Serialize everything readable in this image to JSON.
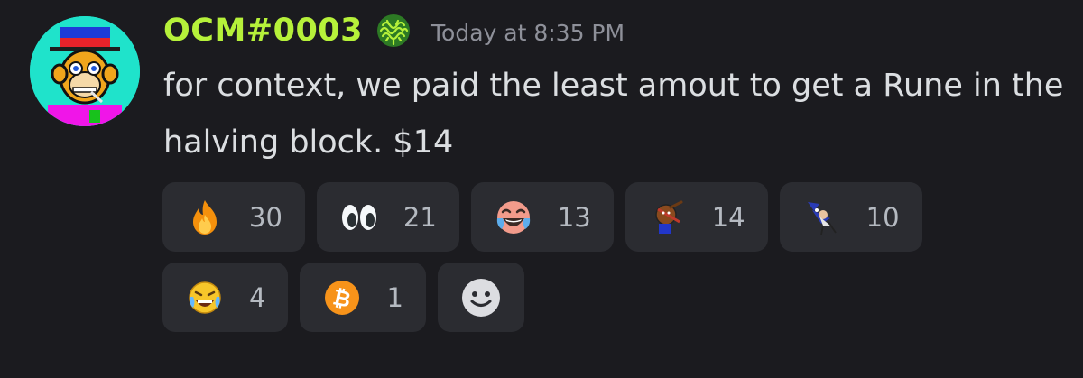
{
  "message": {
    "username": "OCM#0003",
    "timestamp": "Today at 8:35 PM",
    "content": "for context, we paid the least amout to get a Rune in the halving block. $14",
    "colors": {
      "username": "#b6f13a",
      "background": "#1b1b1f",
      "reaction_bg": "#2b2c31"
    }
  },
  "reactions": [
    {
      "emoji": "fire-emoji",
      "count": "30"
    },
    {
      "emoji": "eyes-emoji",
      "count": "21"
    },
    {
      "emoji": "laughing-crying-face-emoji",
      "count": "13"
    },
    {
      "emoji": "custom-monkey-emoji",
      "count": "14"
    },
    {
      "emoji": "custom-wizard-emoji",
      "count": "10"
    },
    {
      "emoji": "pixel-crying-laughing-emoji",
      "count": "4"
    },
    {
      "emoji": "bitcoin-emoji",
      "count": "1"
    }
  ],
  "add_reaction": {
    "icon": "add-reaction-smiley-icon"
  }
}
